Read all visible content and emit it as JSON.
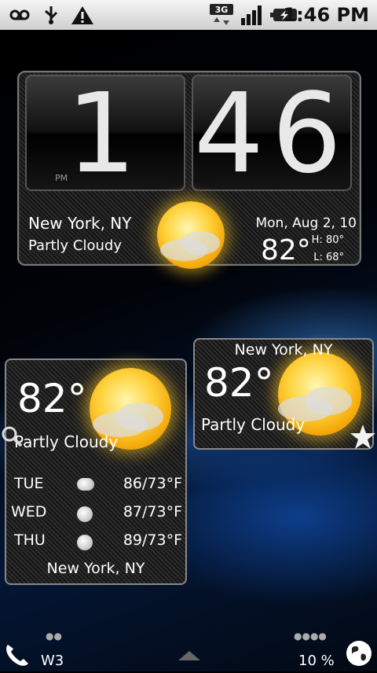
{
  "statusbar": {
    "time": "1:46 PM",
    "icons": [
      "voicemail-icon",
      "usb-icon",
      "warning-icon",
      "3g-icon",
      "signal-icon",
      "battery-charging-icon"
    ]
  },
  "clock_widget": {
    "hour": "1",
    "minute": "46",
    "ampm": "PM",
    "city": "New York, NY",
    "condition": "Partly Cloudy",
    "date": "Mon, Aug 2, 10",
    "temp": "82°",
    "high": "H: 80°",
    "low": "L: 68°"
  },
  "forecast_widget": {
    "temp": "82°",
    "condition": "Partly Cloudy",
    "forecast": [
      {
        "day": "TUE",
        "temps": "86/73°F",
        "icon": "cloud-icon"
      },
      {
        "day": "WED",
        "temps": "87/73°F",
        "icon": "storm-icon"
      },
      {
        "day": "THU",
        "temps": "89/73°F",
        "icon": "storm-icon"
      }
    ],
    "city": "New York, NY"
  },
  "small_widget": {
    "city": "New York, NY",
    "temp": "82°",
    "condition": "Partly Cloudy"
  },
  "dock": {
    "left_label": "W3",
    "right_label": "10 %"
  }
}
